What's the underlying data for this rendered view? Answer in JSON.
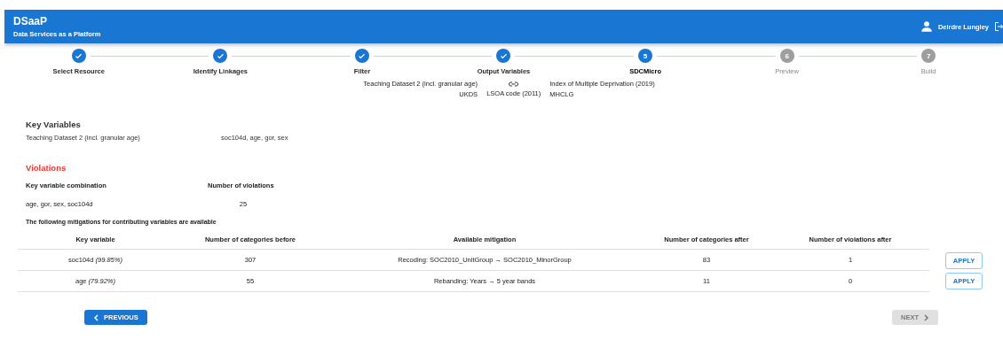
{
  "header": {
    "title": "DSaaP",
    "subtitle": "Data Services as a Platform",
    "user": "Deirdre Lungley"
  },
  "steps": [
    {
      "label": "Select Resource",
      "completed": true,
      "selected": false
    },
    {
      "label": "Identify Linkages",
      "completed": true,
      "selected": false
    },
    {
      "label": "Filter",
      "completed": true,
      "selected": false
    },
    {
      "label": "Output Variables",
      "completed": true,
      "selected": false
    },
    {
      "label": "SDCMicro",
      "number": "5",
      "completed": false,
      "selected": true
    },
    {
      "label": "Preview",
      "number": "6",
      "completed": false,
      "selected": false
    },
    {
      "label": "Build",
      "number": "7",
      "completed": false,
      "selected": false
    }
  ],
  "linkage": {
    "left": {
      "name": "Teaching Dataset 2 (incl. granular age)",
      "source": "UKDS"
    },
    "key": "LSOA code (2011)",
    "right": {
      "name": "Index of Multiple Deprivation (2019)",
      "source": "MHCLG"
    }
  },
  "key_variables": {
    "title": "Key Variables",
    "dataset": "Teaching Dataset 2 (incl. granular age)",
    "variables": "soc104d, age, gor, sex"
  },
  "violations": {
    "title": "Violations",
    "columns": [
      "Key variable combination",
      "Number of violations"
    ],
    "rows": [
      [
        "age, gor, sex, soc104d",
        "25"
      ]
    ]
  },
  "mitigations": {
    "intro": "The following mitigations for contributing variables are available",
    "columns": [
      "Key variable",
      "Number of categories before",
      "Available mitigation",
      "Number of categories after",
      "Number of violations after"
    ],
    "rows": [
      {
        "cells": [
          "soc104d *(99.85%)*",
          "307",
          "Recoding: SOC2010_UnitGroup → SOC2010_MinorGroup",
          "83",
          "1"
        ],
        "action": "APPLY"
      },
      {
        "cells": [
          "age *(79.92%)*",
          "55",
          "Rebanding: Years → 5 year bands",
          "11",
          "0"
        ],
        "action": "APPLY"
      }
    ]
  },
  "nav": {
    "previous": {
      "label": "PREVIOUS",
      "disabled": false
    },
    "next": {
      "label": "NEXT",
      "disabled": true
    }
  }
}
